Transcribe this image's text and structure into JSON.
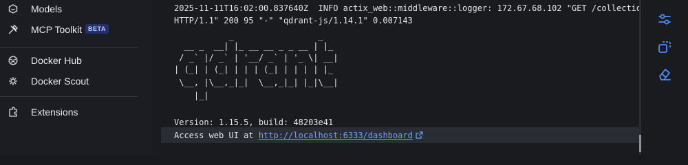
{
  "sidebar": {
    "items": [
      {
        "label": "Models",
        "icon": "models-icon"
      },
      {
        "label": "MCP Toolkit",
        "icon": "toolkit-icon",
        "badge": "BETA"
      },
      {
        "label": "Docker Hub",
        "icon": "docker-hub-icon"
      },
      {
        "label": "Docker Scout",
        "icon": "docker-scout-icon"
      },
      {
        "label": "Extensions",
        "icon": "extensions-icon"
      }
    ]
  },
  "terminal": {
    "log_lines": [
      "2025-11-11T16:02:00.837640Z  INFO actix_web::middleware::logger: 172.67.68.102 \"GET /collections",
      "HTTP/1.1\" 200 95 \"-\" \"qdrant-js/1.14.1\" 0.007143"
    ],
    "ascii_art": [
      "           _                 _",
      "  __ _  __| |_ __ __ _ _ __ | |_",
      " / _` |/ _` | '__/ _` | '_ \\| __|",
      "| (_| | (_| | | | (_| | | | | |_",
      " \\__, |\\__,_|_|  \\__,_|_| |_|\\__|",
      "    |_|"
    ],
    "version_line": "Version: 1.15.5, build: 48203e41",
    "access_prefix": "Access web UI at ",
    "access_url": "http://localhost:6333/dashboard"
  },
  "tools": [
    {
      "name": "settings-sliders-icon"
    },
    {
      "name": "copy-icon"
    },
    {
      "name": "eraser-icon"
    }
  ],
  "colors": {
    "accent": "#4c8dff",
    "link": "#6ea1ff",
    "background": "#18191d",
    "text": "#e3e5ea"
  }
}
